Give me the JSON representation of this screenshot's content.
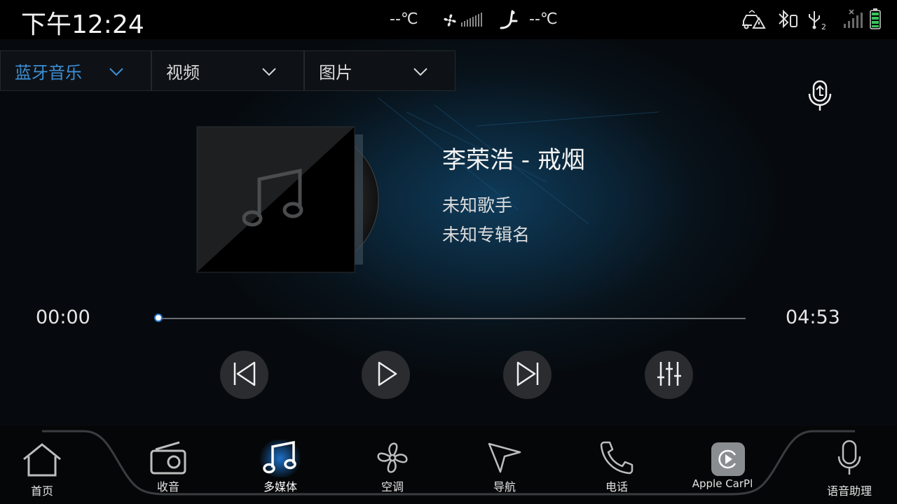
{
  "status": {
    "clock": "下午12:24",
    "temp_left": "--℃",
    "temp_right": "--℃"
  },
  "tabs": [
    {
      "label": "蓝牙音乐",
      "active": true
    },
    {
      "label": "视频",
      "active": false
    },
    {
      "label": "图片",
      "active": false
    }
  ],
  "track": {
    "title": "李荣浩 - 戒烟",
    "artist": "未知歌手",
    "album": "未知专辑名",
    "elapsed": "00:00",
    "total": "04:53",
    "progress": 0
  },
  "dock": {
    "home": "首页",
    "radio": "收音",
    "media": "多媒体",
    "climate": "空调",
    "nav": "导航",
    "phone": "电话",
    "carplay": "Apple CarPl",
    "voice": "语音助理"
  },
  "colors": {
    "accent": "#3d8fd6",
    "active_glow": "#1e6fc4"
  }
}
